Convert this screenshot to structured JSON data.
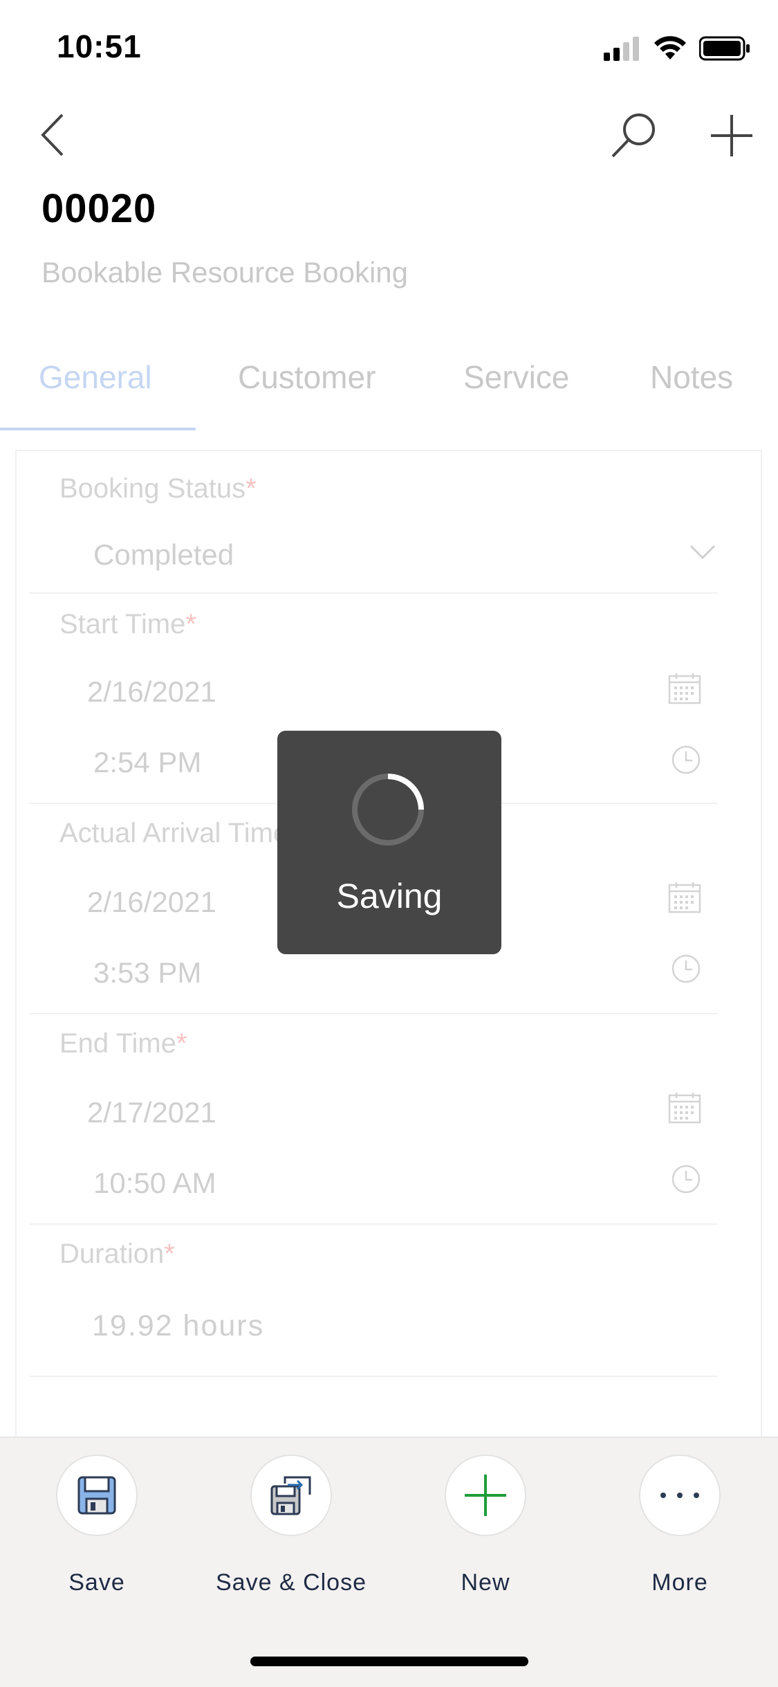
{
  "status_bar": {
    "time": "10:51"
  },
  "header": {
    "record_title": "00020",
    "record_subtitle": "Bookable Resource Booking"
  },
  "tabs": [
    {
      "label": "General",
      "active": true
    },
    {
      "label": "Customer",
      "active": false
    },
    {
      "label": "Service",
      "active": false
    },
    {
      "label": "Notes",
      "active": false
    }
  ],
  "form": {
    "booking_status": {
      "label": "Booking Status",
      "required_mark": "*",
      "value": "Completed"
    },
    "start_time": {
      "label": "Start Time",
      "required_mark": "*",
      "date": "2/16/2021",
      "time": "2:54 PM"
    },
    "actual_arrival_time": {
      "label": "Actual Arrival Time",
      "date": "2/16/2021",
      "time": "3:53 PM"
    },
    "end_time": {
      "label": "End Time",
      "required_mark": "*",
      "date": "2/17/2021",
      "time": "10:50 AM"
    },
    "duration": {
      "label": "Duration",
      "required_mark": "*",
      "value": "19.92 hours"
    }
  },
  "overlay": {
    "text": "Saving"
  },
  "command_bar": {
    "save_label": "Save",
    "save_close_label": "Save & Close",
    "new_label": "New",
    "more_label": "More"
  },
  "icons": {
    "back": "chevron-left-icon",
    "search": "search-icon",
    "add": "plus-icon",
    "dropdown": "chevron-down-icon",
    "calendar": "calendar-icon",
    "clock": "clock-icon",
    "save": "save-icon",
    "save_close": "save-and-close-icon",
    "new": "plus-icon",
    "more": "more-icon"
  },
  "colors": {
    "active_tab": "#c5d6f2",
    "required": "#f5c2c2",
    "overlay_bg": "#464646",
    "new_icon": "#1f9d3a",
    "save_icon_blue": "#2b6cb0"
  }
}
